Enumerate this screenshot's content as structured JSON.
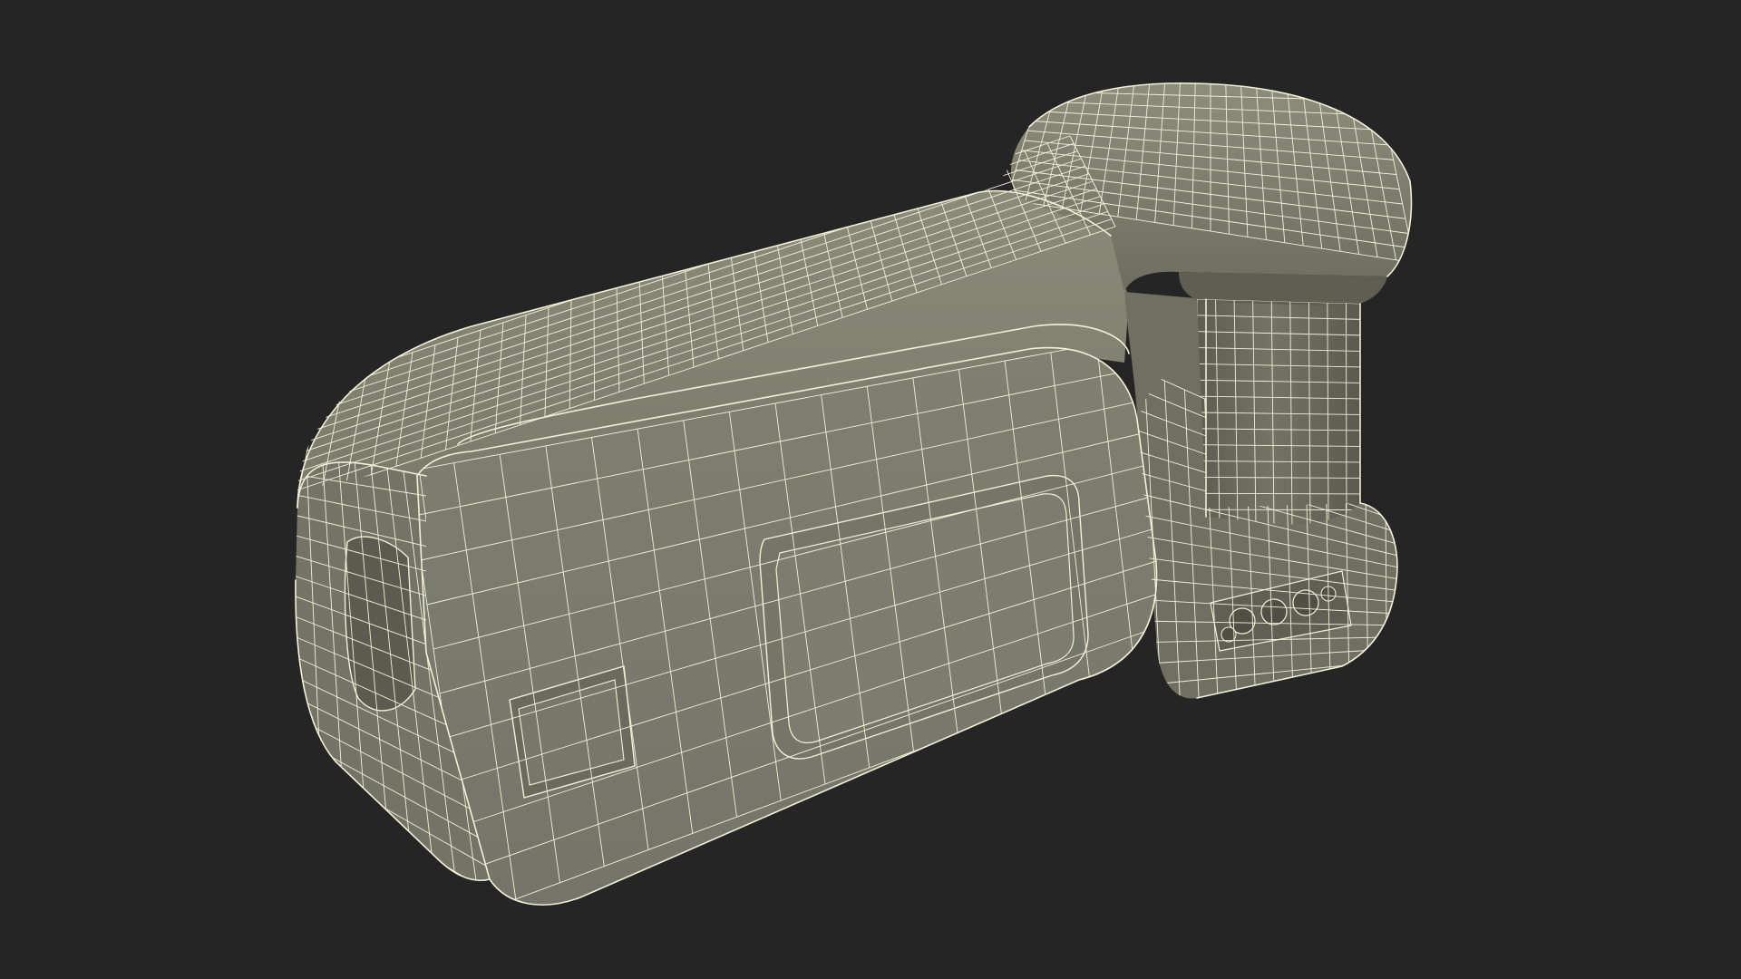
{
  "scene": {
    "kind": "3d-wireframe-render",
    "subject": "wireframe-model",
    "colors": {
      "background": "#252525",
      "surface": "#7c7c6c",
      "surface_light": "#8a8a79",
      "surface_dark": "#666657",
      "surface_darker": "#55554a",
      "wire": "#f2f0d8"
    }
  }
}
